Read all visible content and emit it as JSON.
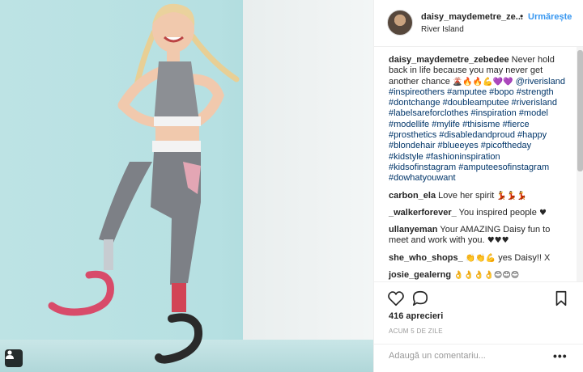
{
  "post": {
    "username": "daisy_maydemetre_ze...",
    "follow_dot": "•",
    "follow_label": "Urmărește",
    "location": "River Island"
  },
  "caption": {
    "author": "daisy_maydemetre_zebedee",
    "text": "Never hold back in life because you may never get another chance",
    "emojis": "🌋🔥🔥💪💜💜",
    "mentions": "@riverisland #inspireothers #amputee #bopo #strength #dontchange #doubleamputee #riverisland #labelsareforclothes #inspiration #model #modellife #mylife #thisisme #fierce #prosthetics #disabledandproud #happy #blondehair #blueeyes #picoftheday #kidstyle #fashioninspiration #kidsofinstagram #amputeesofinstagram #dowhatyouwant"
  },
  "comments": [
    {
      "user": "carbon_ela",
      "text": "Love her spirit",
      "emoji": "💃💃💃"
    },
    {
      "user": "_walkerforever_",
      "text": "You inspired people",
      "emoji": "♥"
    },
    {
      "user": "ullanyeman",
      "text": "Your AMAZING Daisy fun to meet and work with you.",
      "emoji": "♥♥♥"
    },
    {
      "user": "she_who_shops_",
      "text": "yes Daisy!! X",
      "emoji_before": "👏👏💪"
    },
    {
      "user": "josie_gealerng",
      "text": "",
      "emoji": "👌👌👌👌😊😊😊"
    }
  ],
  "actions": {
    "likes": "416 aprecieri",
    "timestamp": "ACUM 5 DE ZILE",
    "comment_placeholder": "Adaugă un comentariu...",
    "more_label": "•••"
  },
  "icons": [
    "heart-icon",
    "comment-icon",
    "bookmark-icon",
    "user-tag-icon"
  ]
}
